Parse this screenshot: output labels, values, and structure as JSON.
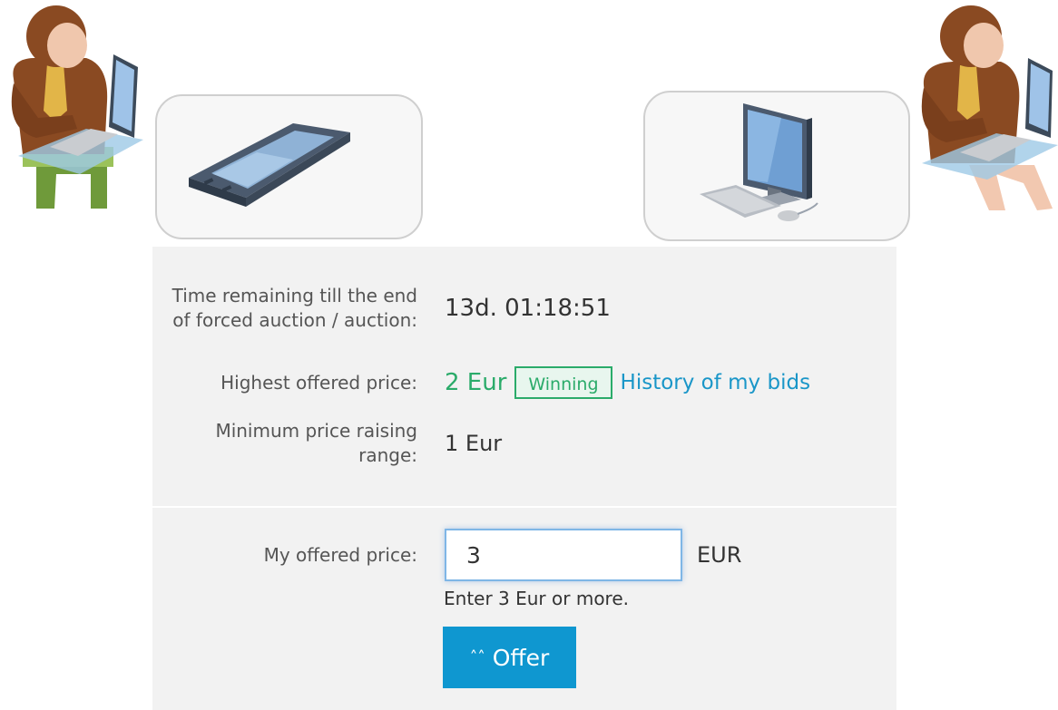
{
  "auction": {
    "time_label": "Time remaining till the end of forced auction / auction:",
    "time_value": "13d. 01:18:51",
    "highest_label": "Highest offered price:",
    "highest_value": "2 Eur",
    "winning_badge": "Winning",
    "history_link": "History of my bids",
    "min_raise_label": "Minimum price raising range:",
    "min_raise_value": "1 Eur"
  },
  "offer": {
    "label": "My offered price:",
    "input_value": "3",
    "currency": "EUR",
    "hint": "Enter 3 Eur or more.",
    "button_label": "Offer",
    "button_icon": "double-chevron-up-icon"
  },
  "illustrations": {
    "left_person": "person-with-laptop-icon",
    "left_device": "mobile-phone-icon",
    "right_device": "desktop-computer-icon",
    "right_person": "person-with-laptop-icon"
  },
  "colors": {
    "winning": "#2bab6a",
    "link": "#1a96c8",
    "button": "#0f97d0",
    "panel": "#f2f2f2"
  }
}
